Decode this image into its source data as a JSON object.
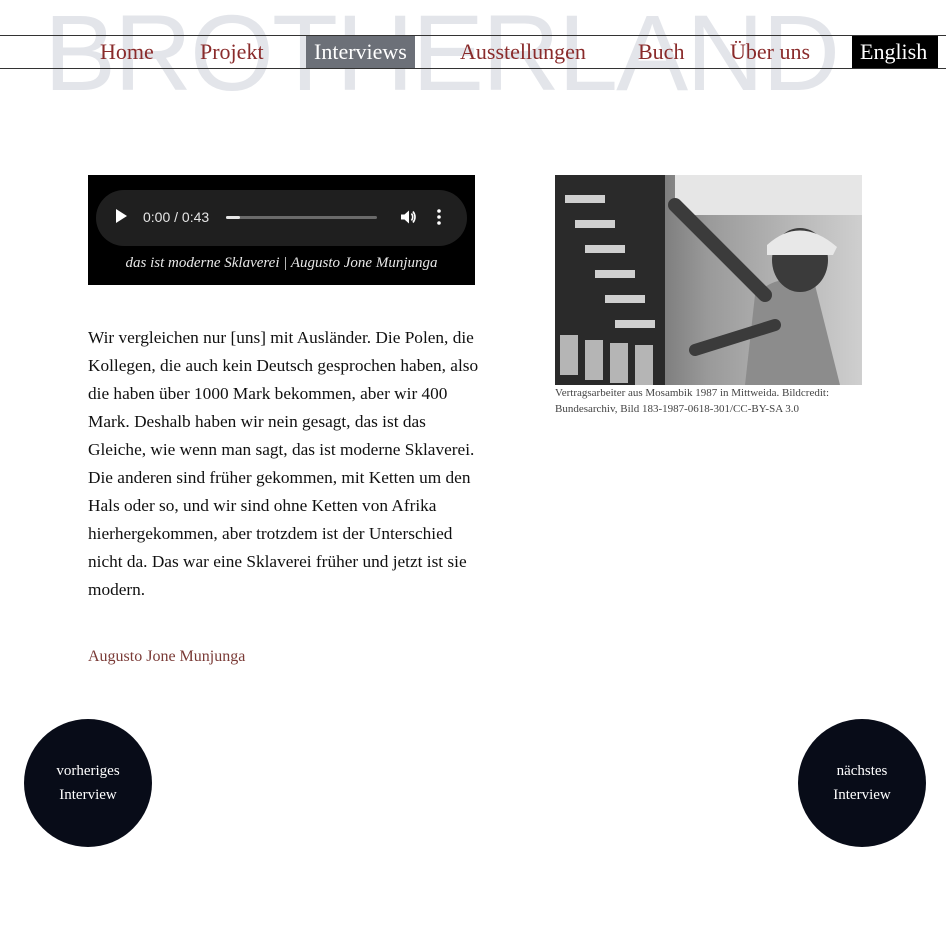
{
  "site": {
    "watermark": "BROTHERLAND"
  },
  "nav": {
    "items": [
      {
        "label": "Home"
      },
      {
        "label": "Projekt"
      },
      {
        "label": "Interviews"
      },
      {
        "label": "Ausstellungen"
      },
      {
        "label": "Buch"
      },
      {
        "label": "Über uns"
      }
    ],
    "language": "English",
    "active": "Interviews"
  },
  "audio": {
    "time": "0:00 / 0:43",
    "progress_fraction": 0.09,
    "caption": "das ist moderne Sklaverei | Augusto Jone Munjunga"
  },
  "quote": {
    "text": "Wir vergleichen nur [uns] mit Ausländer. Die Polen, die Kollegen, die auch kein Deutsch gesprochen haben, also die haben über 1000 Mark bekommen, aber wir 400 Mark. Deshalb haben wir nein gesagt, das ist das Gleiche, wie wenn man sagt, das ist moderne Sklaverei. Die anderen sind früher gekommen, mit Ketten um den Hals oder so, und wir sind ohne Ketten von Afrika hierhergekommen, aber trotzdem ist der Unterschied nicht da. Das war eine Sklaverei früher und jetzt ist sie modern.",
    "author": "Augusto Jone Munjunga"
  },
  "photo": {
    "caption": "Vertragsarbeiter aus Mosambik 1987 in Mittweida. Bildcredit: Bundesarchiv, Bild 183-1987-0618-301/CC-BY-SA 3.0"
  },
  "pager": {
    "prev_line1": "vorheriges",
    "prev_line2": "Interview",
    "next_line1": "nächstes",
    "next_line2": "Interview"
  },
  "colors": {
    "nav_link": "#8a2b2b",
    "nav_active_bg": "#6c7078",
    "author": "#7a3a36",
    "circle_bg": "#080c18",
    "watermark": "#e3e5ea"
  }
}
